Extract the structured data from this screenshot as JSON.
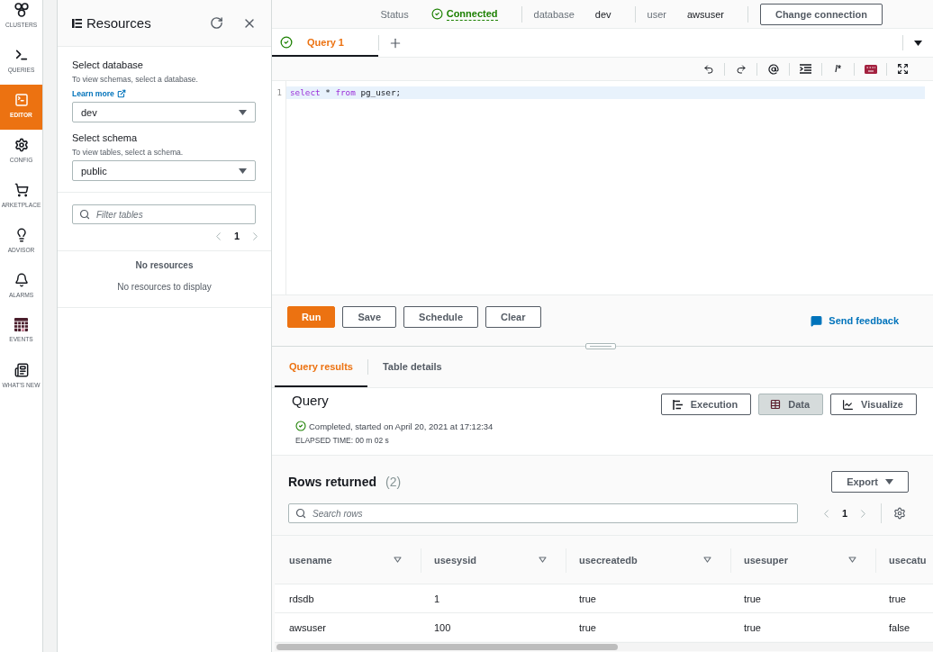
{
  "nav": {
    "items": [
      {
        "label": "CLUSTERS",
        "selected": false
      },
      {
        "label": "QUERIES",
        "selected": false
      },
      {
        "label": "EDITOR",
        "selected": true
      },
      {
        "label": "CONFIG",
        "selected": false
      },
      {
        "label": "ARKETPLACE",
        "selected": false
      },
      {
        "label": "ADVISOR",
        "selected": false
      },
      {
        "label": "ALARMS",
        "selected": false
      },
      {
        "label": "EVENTS",
        "selected": false
      },
      {
        "label": "WHAT'S NEW",
        "selected": false
      }
    ]
  },
  "resources": {
    "title": "Resources",
    "database": {
      "label": "Select database",
      "hint": "To view schemas, select a database.",
      "link": "Learn more",
      "value": "dev"
    },
    "schema": {
      "label": "Select schema",
      "hint": "To view tables, select a schema.",
      "value": "public"
    },
    "filter": {
      "placeholder": "Filter tables"
    },
    "pagination": {
      "page": "1",
      "previous_disabled": true,
      "next_disabled": true
    },
    "empty": {
      "title": "No resources",
      "message": "No resources to display"
    }
  },
  "connection": {
    "status_label": "Status",
    "status": "Connected",
    "fields": [
      {
        "label": "database",
        "value": "dev"
      },
      {
        "label": "user",
        "value": "awsuser"
      }
    ],
    "button": "Change connection"
  },
  "query_tabs": [
    {
      "label": "Query 1",
      "selected": true
    }
  ],
  "editor_toolbar": {
    "comment": "/*"
  },
  "editor": {
    "lines": [
      {
        "number": "1",
        "active": true,
        "tokens": [
          {
            "text": "select",
            "kind": "keyword"
          },
          {
            "text": " * ",
            "kind": "plain"
          },
          {
            "text": "from",
            "kind": "keyword"
          },
          {
            "text": " pg_user;",
            "kind": "plain"
          }
        ]
      }
    ]
  },
  "actions": [
    {
      "label": "Run",
      "kind": "primary"
    },
    {
      "label": "Save",
      "kind": "secondary"
    },
    {
      "label": "Schedule",
      "kind": "secondary"
    },
    {
      "label": "Clear",
      "kind": "secondary"
    }
  ],
  "feedback": "Send feedback",
  "result_tabs": [
    {
      "label": "Query results",
      "selected": true
    },
    {
      "label": "Table details",
      "selected": false
    }
  ],
  "query": {
    "title": "Query",
    "views": [
      {
        "label": "Execution",
        "selected": false
      },
      {
        "label": "Data",
        "selected": true
      },
      {
        "label": "Visualize",
        "selected": false
      }
    ],
    "status": "Completed, started on April 20, 2021 at 17:12:34",
    "elapsed": "ELAPSED TIME: 00 m 02 s"
  },
  "rows": {
    "title": "Rows returned",
    "count": "(2)",
    "export": "Export",
    "search": {
      "placeholder": "Search rows"
    },
    "pagination": {
      "page": "1",
      "previous_disabled": true,
      "next_disabled": true
    }
  },
  "table": {
    "columns": [
      "usename",
      "usesysid",
      "usecreatedb",
      "usesuper",
      "usecatu"
    ],
    "rows": [
      [
        "rdsdb",
        "1",
        "true",
        "true",
        "true"
      ],
      [
        "awsuser",
        "100",
        "true",
        "true",
        "false"
      ]
    ]
  }
}
